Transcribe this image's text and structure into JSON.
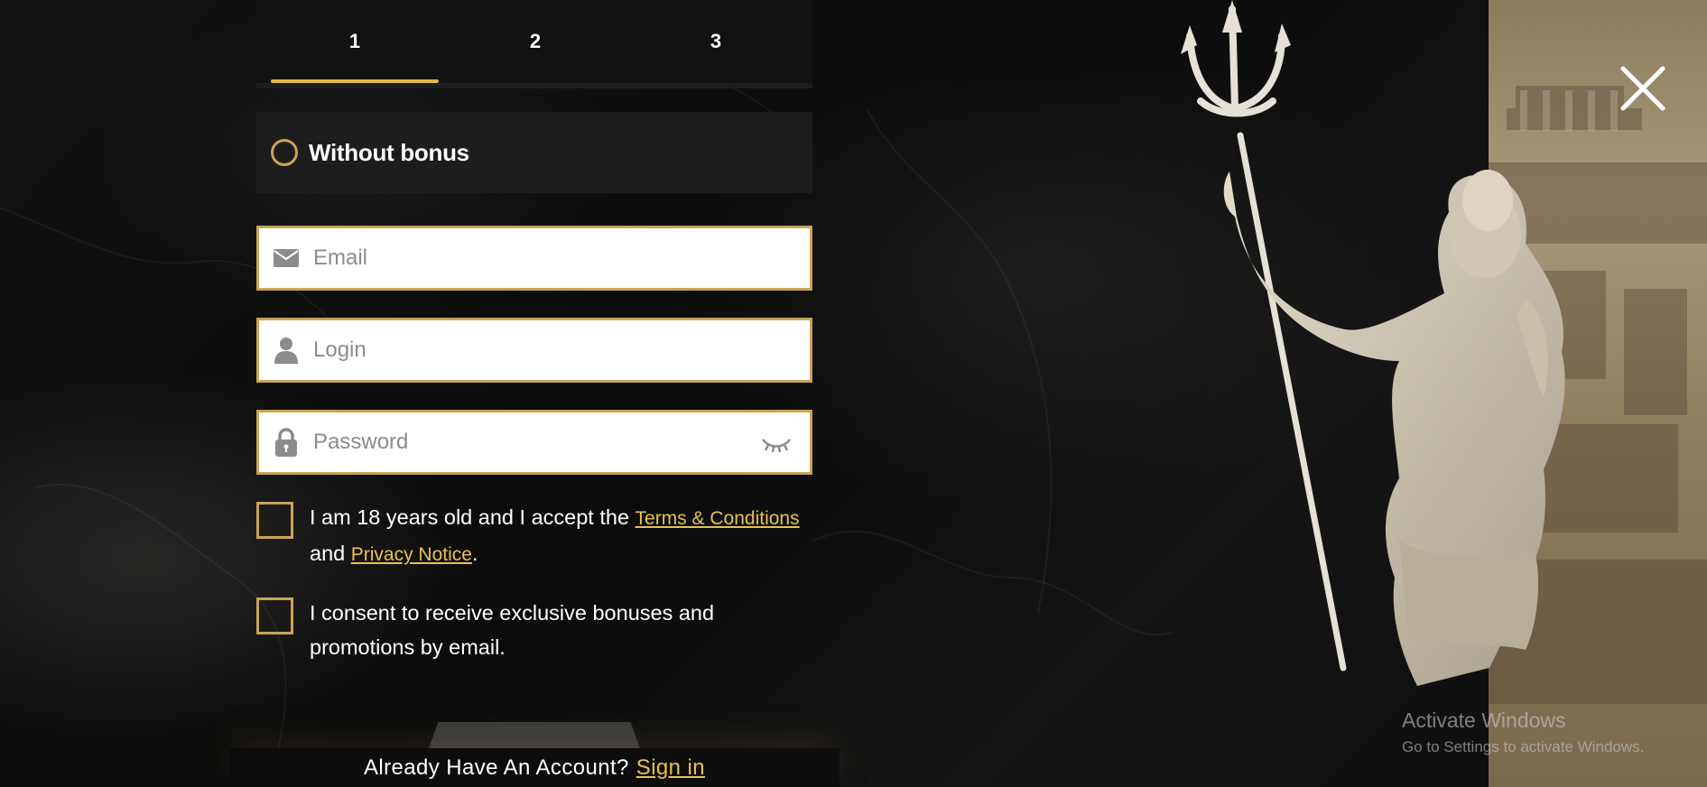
{
  "steps": [
    "1",
    "2",
    "3"
  ],
  "active_step": "1",
  "bonus": {
    "label": "Without bonus",
    "selected": false
  },
  "form": {
    "email_placeholder": "Email",
    "login_placeholder": "Login",
    "password_placeholder": "Password"
  },
  "terms": {
    "text_before": "I am 18 years old and I accept the ",
    "terms_link": "Terms & Conditions",
    "text_and": "and ",
    "privacy_link": "Privacy Notice",
    "text_end": "."
  },
  "consent": {
    "line1": "I consent to receive exclusive bonuses and",
    "line2": "promotions by email."
  },
  "footer": {
    "question": "Already Have An Account?",
    "signin_link": "Sign in"
  },
  "watermark": {
    "title": "Activate Windows",
    "subtitle": "Go to Settings to activate Windows."
  },
  "icons": {
    "email": "envelope-icon",
    "login": "user-icon",
    "password": "lock-icon",
    "toggle_password": "eye-closed-icon",
    "close": "close-icon"
  },
  "colors": {
    "accent": "#e2b946",
    "field_border": "#c8a555",
    "link": "#e9c14f",
    "panel": "#1d1d1d"
  }
}
